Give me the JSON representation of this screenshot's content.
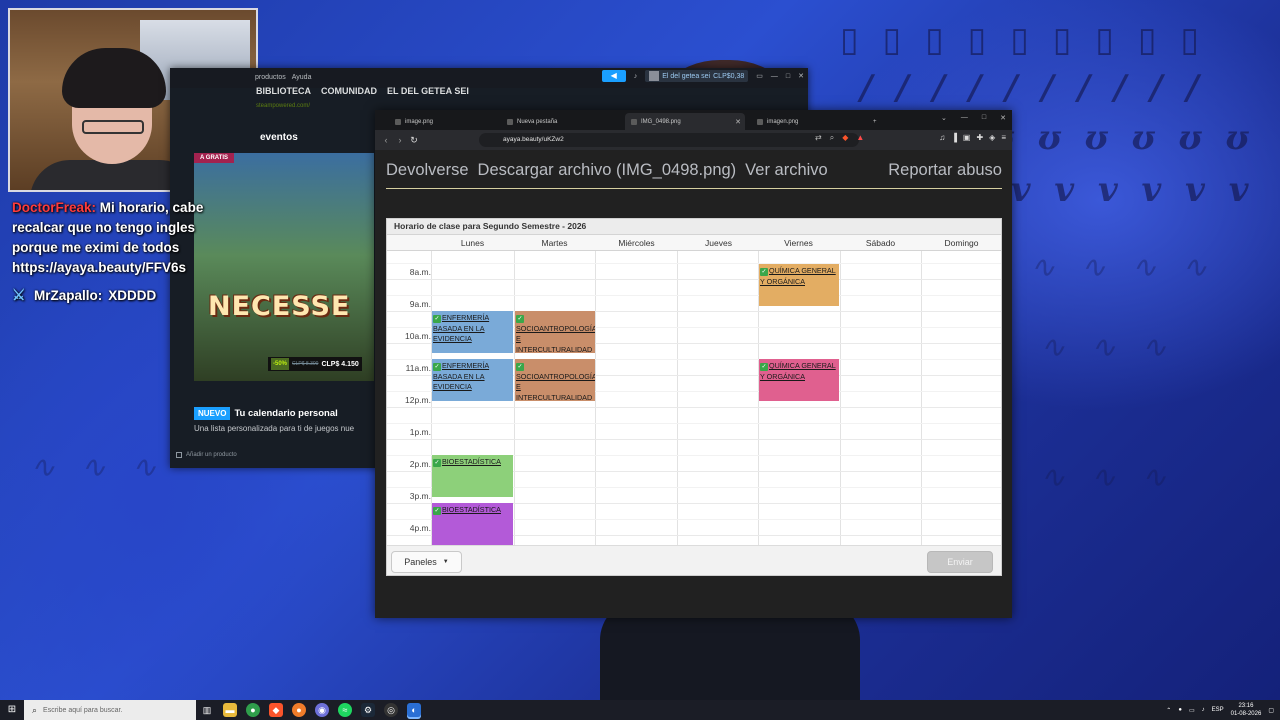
{
  "chat": {
    "msg1_user": "DoctorFreak:",
    "msg1_text": "Mi horario, cabe recalcar que no tengo ingles porque me eximi de todos https://ayaya.beauty/FFV6s",
    "msg2_user": "MrZapallo:",
    "msg2_text": "XDDDD"
  },
  "steam": {
    "menu": [
      "productos",
      "Ayuda"
    ],
    "user": "El del getea sei",
    "balance": "CLP$0,38",
    "nav": [
      "BIBLIOTECA",
      "COMUNIDAD",
      "EL DEL GETEA SEI"
    ],
    "url": "steampowered.com/",
    "events": "eventos",
    "banner_tag": "A GRATIS",
    "banner_title": "NECESSE",
    "discount": "-50%",
    "original_price": "CLP$ 8.300",
    "final_price": "CLP$ 4.150",
    "new_badge": "NUEVO",
    "new_title": "Tu calendario personal",
    "new_sub": "Una lista personalizada para ti de juegos nue",
    "add_product": "Añadir un producto"
  },
  "browser": {
    "tabs": [
      {
        "label": "image.png"
      },
      {
        "label": "Nueva pestaña"
      },
      {
        "label": "IMG_0498.png"
      },
      {
        "label": "imagen.png"
      }
    ],
    "url": "ayaya.beauty/uKZw2"
  },
  "page": {
    "nav_back": "Devolverse",
    "nav_download": "Descargar archivo (IMG_0498.png)",
    "nav_view": "Ver archivo",
    "nav_report": "Reportar abuso"
  },
  "calendar": {
    "title": "Horario de clase para Segundo Semestre - 2026",
    "days": [
      "Lunes",
      "Martes",
      "Miércoles",
      "Jueves",
      "Viernes",
      "Sábado",
      "Domingo"
    ],
    "hours": [
      "8a.m.",
      "9a.m.",
      "10a.m.",
      "11a.m.",
      "12p.m.",
      "1p.m.",
      "2p.m.",
      "3p.m.",
      "4p.m."
    ],
    "events": [
      {
        "name": "QUÍMICA GENERAL Y ORGÁNICA",
        "day": "Viernes",
        "color": "#e3ad63"
      },
      {
        "name": "ENFERMERÍA BASADA EN LA EVIDENCIA",
        "day": "Lunes",
        "color": "#7aaad8"
      },
      {
        "name": "SOCIOANTROPOLOGÍA E INTERCULTURALIDAD PARA EL CUIDADO",
        "day": "Martes",
        "color": "#c98e6a"
      },
      {
        "name": "ENFERMERÍA BASADA EN LA EVIDENCIA",
        "day": "Lunes",
        "color": "#7aaad8"
      },
      {
        "name": "SOCIOANTROPOLOGÍA E INTERCULTURALIDAD PARA EL CUIDADO",
        "day": "Martes",
        "color": "#c98e6a"
      },
      {
        "name": "QUÍMICA GENERAL Y ORGÁNICA",
        "day": "Viernes",
        "color": "#e0608f"
      },
      {
        "name": "BIOESTADÍSTICA",
        "day": "Lunes",
        "color": "#8dd07a"
      },
      {
        "name": "BIOESTADÍSTICA",
        "day": "Lunes",
        "color": "#b35ad8"
      }
    ],
    "paneles": "Paneles",
    "enviar": "Enviar"
  },
  "taskbar": {
    "search_placeholder": "Escribe aquí para buscar.",
    "lang": "ESP",
    "time": "23:16",
    "date": "01-08-2026"
  }
}
